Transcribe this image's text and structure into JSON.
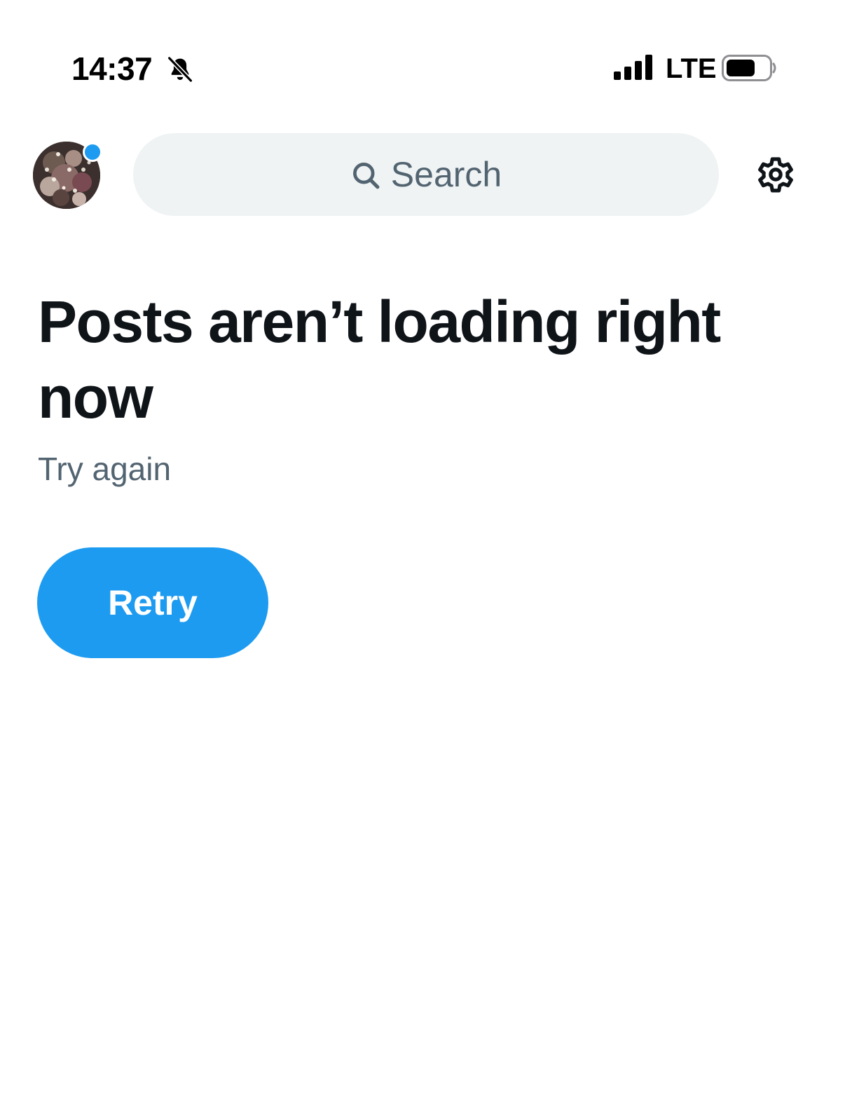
{
  "status_bar": {
    "time": "14:37",
    "mute_icon": "bell-slash-icon",
    "signal_icon": "cellular-signal-icon",
    "network": "LTE",
    "battery_icon": "battery-icon"
  },
  "header": {
    "avatar_icon": "profile-avatar",
    "notification_dot_color": "#1d9bf0",
    "search": {
      "icon": "search-icon",
      "placeholder": "Search"
    },
    "settings_icon": "gear-icon"
  },
  "error": {
    "title": "Posts aren’t loading right now",
    "subtitle": "Try again",
    "retry_label": "Retry"
  },
  "colors": {
    "accent": "#1d9bf0",
    "text_primary": "#0f1419",
    "text_secondary": "#536471",
    "search_background": "#eff3f4"
  }
}
